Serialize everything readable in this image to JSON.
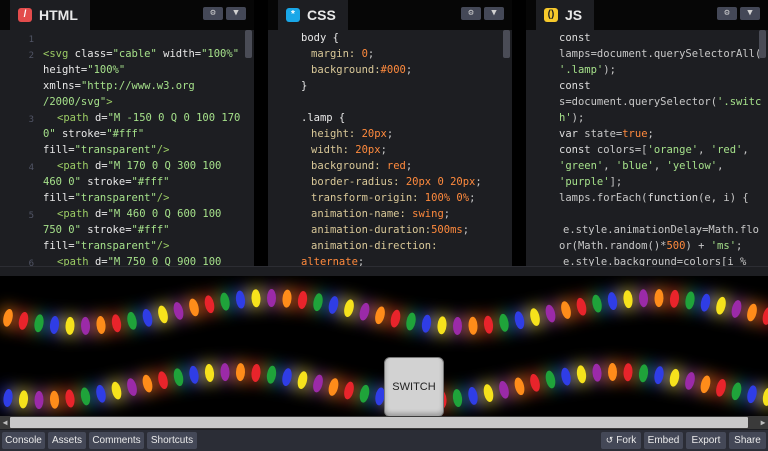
{
  "colors": {
    "html": "#e34c4c",
    "css": "#19a7e8",
    "js": "#f7c92b"
  },
  "panes": {
    "html": {
      "title": "HTML",
      "icon": "/"
    },
    "css": {
      "title": "CSS",
      "icon": "*"
    },
    "js": {
      "title": "JS",
      "icon": "()"
    }
  },
  "icons": {
    "settings": "gear-icon",
    "collapse": "chevron-down-icon",
    "fork": "fork-icon"
  },
  "preview": {
    "switch_label": "SWITCH",
    "lamp_colors": [
      "orange",
      "red",
      "green",
      "blue",
      "yellow",
      "purple"
    ]
  },
  "footer": {
    "console": "Console",
    "assets": "Assets",
    "comments": "Comments",
    "shortcuts": "Shortcuts",
    "fork": "Fork",
    "embed": "Embed",
    "export": "Export",
    "share": "Share"
  }
}
